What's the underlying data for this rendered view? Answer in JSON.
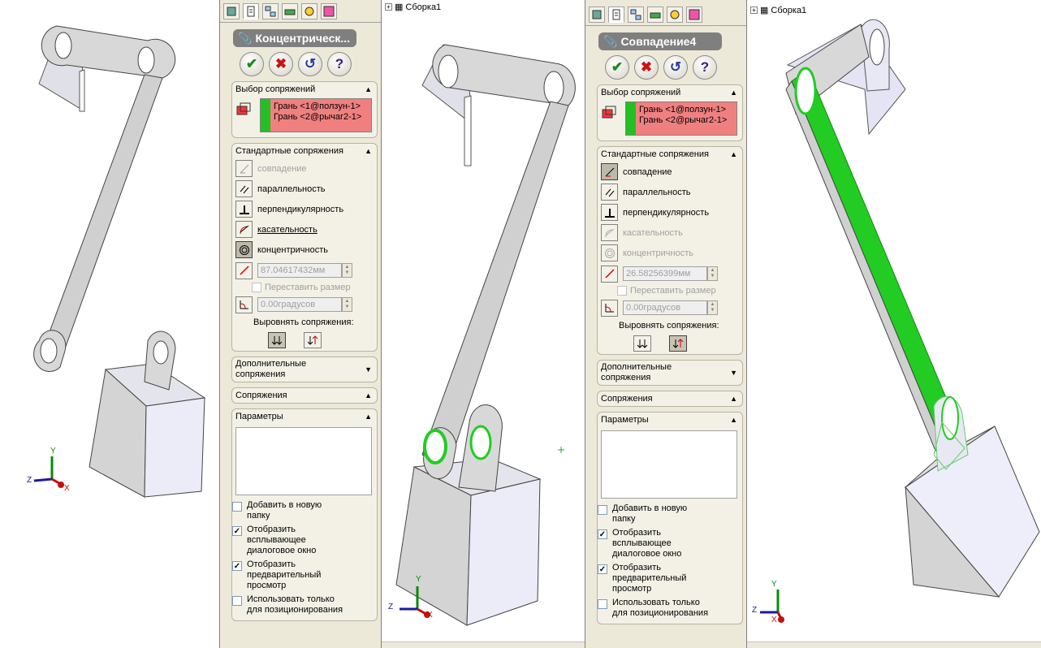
{
  "left_viewport": {
    "triad": {
      "y": "Y",
      "z": "Z",
      "x": "X"
    }
  },
  "panel1": {
    "tabs": [
      "feature-manager-icon",
      "property-manager-icon",
      "configuration-manager-icon",
      "dim-xpert-icon",
      "display-manager-icon",
      "appearance-icon"
    ],
    "title": "Концентрическ...",
    "buttons": {
      "ok": "✔",
      "cancel": "✖",
      "undo": "↺",
      "help": "?"
    },
    "selection": {
      "header": "Выбор сопряжений",
      "items": [
        "Грань <1@ползун-1>",
        "Грань <2@рычаг2-1>"
      ]
    },
    "standard": {
      "header": "Стандартные сопряжения",
      "coincident": "совпадение",
      "parallel": "параллельность",
      "perpendicular": "перпендикулярность",
      "tangent": "касательность",
      "concentric": "концентричность",
      "distance_value": "87.04617432мм",
      "flip_dimension": "Переставить размер",
      "angle_value": "0.00градусов",
      "align_label": "Выровнять сопряжения:"
    },
    "advanced": {
      "header": "Дополнительные сопряжения"
    },
    "mates": {
      "header": "Сопряжения"
    },
    "options": {
      "header": "Параметры",
      "add_to_folder": "Добавить в новую папку",
      "show_popup": "Отобразить всплывающее диалоговое окно",
      "show_preview": "Отобразить предварительный просмотр",
      "positioning_only": "Использовать только для позиционирования"
    }
  },
  "middle_viewport": {
    "tree_root": "Сборка1",
    "triad": {
      "y": "Y",
      "z": "Z",
      "x": "X"
    },
    "origin_mark": "+"
  },
  "panel2": {
    "title": "Совпадение4",
    "buttons": {
      "ok": "✔",
      "cancel": "✖",
      "undo": "↺",
      "help": "?"
    },
    "selection": {
      "header": "Выбор сопряжений",
      "items": [
        "Грань <1@ползун-1>",
        "Грань <2@рычаг2-1>"
      ]
    },
    "standard": {
      "header": "Стандартные сопряжения",
      "coincident": "совпадение",
      "parallel": "параллельность",
      "perpendicular": "перпендикулярность",
      "tangent": "касательность",
      "concentric": "концентричность",
      "distance_value": "26.58256399мм",
      "flip_dimension": "Переставить размер",
      "angle_value": "0.00градусов",
      "align_label": "Выровнять сопряжения:"
    },
    "advanced": {
      "header": "Дополнительные сопряжения"
    },
    "mates": {
      "header": "Сопряжения"
    },
    "options": {
      "header": "Параметры",
      "add_to_folder": "Добавить в новую папку",
      "show_popup": "Отобразить всплывающее диалоговое окно",
      "show_preview": "Отобразить предварительный просмотр",
      "positioning_only": "Использовать только для позиционирования"
    }
  },
  "right_viewport": {
    "tree_root": "Сборка1",
    "triad": {
      "y": "Y",
      "z": "Z",
      "x": "X"
    }
  },
  "colors": {
    "panel_bg": "#ece9d8",
    "selection_bg": "#f08080",
    "selected_face": "#22cc22",
    "part_gray": "#d8d8d8"
  }
}
